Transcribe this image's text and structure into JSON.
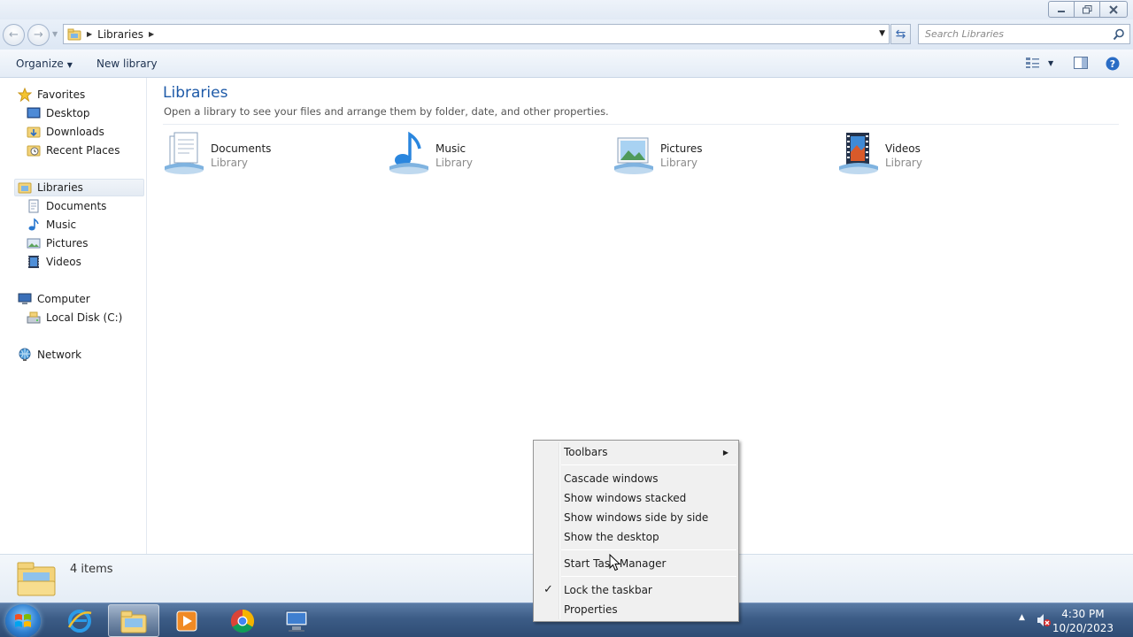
{
  "address": {
    "path_label": "Libraries",
    "search_placeholder": "Search Libraries"
  },
  "toolbar": {
    "organize_label": "Organize",
    "new_library_label": "New library"
  },
  "nav": {
    "favorites": "Favorites",
    "desktop": "Desktop",
    "downloads": "Downloads",
    "recent_places": "Recent Places",
    "libraries": "Libraries",
    "documents": "Documents",
    "music": "Music",
    "pictures": "Pictures",
    "videos": "Videos",
    "computer": "Computer",
    "local_disk": "Local Disk (C:)",
    "network": "Network"
  },
  "content": {
    "title": "Libraries",
    "subtitle": "Open a library to see your files and arrange them by folder, date, and other properties.",
    "libraries": [
      {
        "name": "Documents",
        "type": "Library",
        "icon": "documents-library-icon"
      },
      {
        "name": "Music",
        "type": "Library",
        "icon": "music-library-icon"
      },
      {
        "name": "Pictures",
        "type": "Library",
        "icon": "pictures-library-icon"
      },
      {
        "name": "Videos",
        "type": "Library",
        "icon": "videos-library-icon"
      }
    ]
  },
  "details": {
    "item_count": "4 items"
  },
  "context_menu": {
    "toolbars": "Toolbars",
    "cascade": "Cascade windows",
    "stacked": "Show windows stacked",
    "side_by_side": "Show windows side by side",
    "show_desktop": "Show the desktop",
    "task_manager": "Start Task Manager",
    "lock_taskbar": "Lock the taskbar",
    "lock_checked": true,
    "properties": "Properties"
  },
  "taskbar": {
    "time": "4:30 PM",
    "date": "10/20/2023",
    "apps": [
      "internet-explorer-icon",
      "windows-explorer-icon",
      "media-player-icon",
      "chrome-icon",
      "remote-desktop-icon"
    ]
  },
  "colors": {
    "accent_title": "#1e5aa8",
    "taskbar": "#3c5c86",
    "menu_bg": "#f0f0f0"
  }
}
